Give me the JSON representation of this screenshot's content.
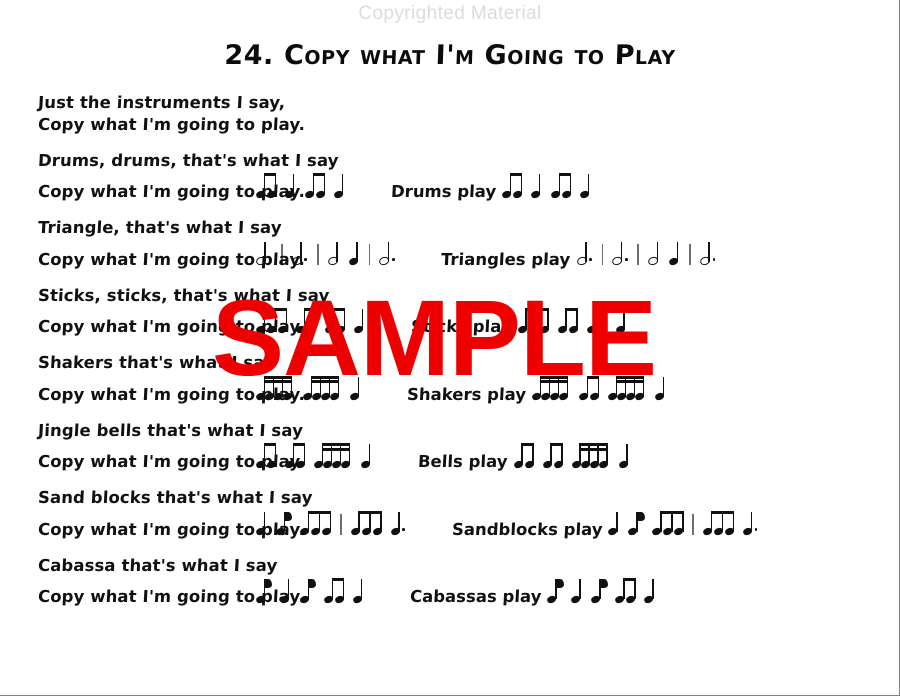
{
  "page": {
    "copyright_banner": "Copyrighted Material",
    "title": "24. Copy what I'm Going to Play",
    "watermark": "SAMPLE",
    "watermark_color": "#ee0000",
    "banner_color": "#dcdcdc",
    "text_color": "#111111"
  },
  "verses": [
    {
      "name": "intro",
      "line1": "Just the instruments I say,",
      "line2": "Copy what I'm going to play.",
      "response_label": "",
      "call_rhythm": [],
      "response_rhythm": []
    },
    {
      "name": "drums",
      "line1": "Drums, drums, that's what I say",
      "line2": "Copy what I'm going to play.",
      "response_label": "Drums play",
      "call_rhythm": [
        "beam2",
        "quarter",
        "beam2",
        "quarter"
      ],
      "response_rhythm": [
        "beam2",
        "quarter",
        "beam2",
        "quarter"
      ]
    },
    {
      "name": "triangle",
      "line1": "Triangle, that's what I say",
      "line2": "Copy what I'm going to play.",
      "response_label": "Triangles play",
      "call_rhythm": [
        "half-dot",
        "bar",
        "half-dot",
        "bar",
        "half",
        "quarter",
        "bar",
        "half-dot"
      ],
      "response_rhythm": [
        "half-dot",
        "bar",
        "half-dot",
        "bar",
        "half",
        "quarter",
        "bar",
        "half-dot"
      ]
    },
    {
      "name": "sticks",
      "line1": "Sticks, sticks, that's what I say",
      "line2": "Copy what I'm going to play.",
      "response_label": "Sticks play",
      "call_rhythm": [
        "beam3",
        "beam2",
        "beam2",
        "quarter"
      ],
      "response_rhythm": [
        "beam3",
        "beam2",
        "beam2",
        "quarter"
      ]
    },
    {
      "name": "shakers",
      "line1": "Shakers that's what I say",
      "line2": "Copy what I'm going to play.",
      "response_label": "Shakers play",
      "call_rhythm": [
        "beam4",
        "beam4",
        "quarter"
      ],
      "response_rhythm": [
        "beam4",
        "beam2",
        "beam4",
        "quarter"
      ]
    },
    {
      "name": "jingle-bells",
      "line1": "Jingle bells that's what I say",
      "line2": "Copy what I'm going to play.",
      "response_label": "Bells play",
      "call_rhythm": [
        "beam2",
        "beam2",
        "beam4",
        "quarter"
      ],
      "response_rhythm": [
        "beam2",
        "beam2",
        "beam4",
        "quarter"
      ]
    },
    {
      "name": "sand-blocks",
      "line1": "Sand blocks that's what I say",
      "line2": "Copy what I'm going to play.",
      "response_label": "Sandblocks play",
      "call_rhythm": [
        "quarter",
        "eighth",
        "beam3",
        "bar",
        "beam3",
        "quarter-dot"
      ],
      "response_rhythm": [
        "quarter",
        "eighth",
        "beam3",
        "bar",
        "beam3",
        "quarter-dot"
      ]
    },
    {
      "name": "cabassa",
      "line1": "Cabassa that's what I say",
      "line2": "Copy what I'm going to play.",
      "response_label": "Cabassas play",
      "call_rhythm": [
        "eighth",
        "quarter",
        "eighth",
        "beam2",
        "quarter"
      ],
      "response_rhythm": [
        "eighth",
        "quarter",
        "eighth",
        "beam2",
        "quarter"
      ]
    }
  ]
}
